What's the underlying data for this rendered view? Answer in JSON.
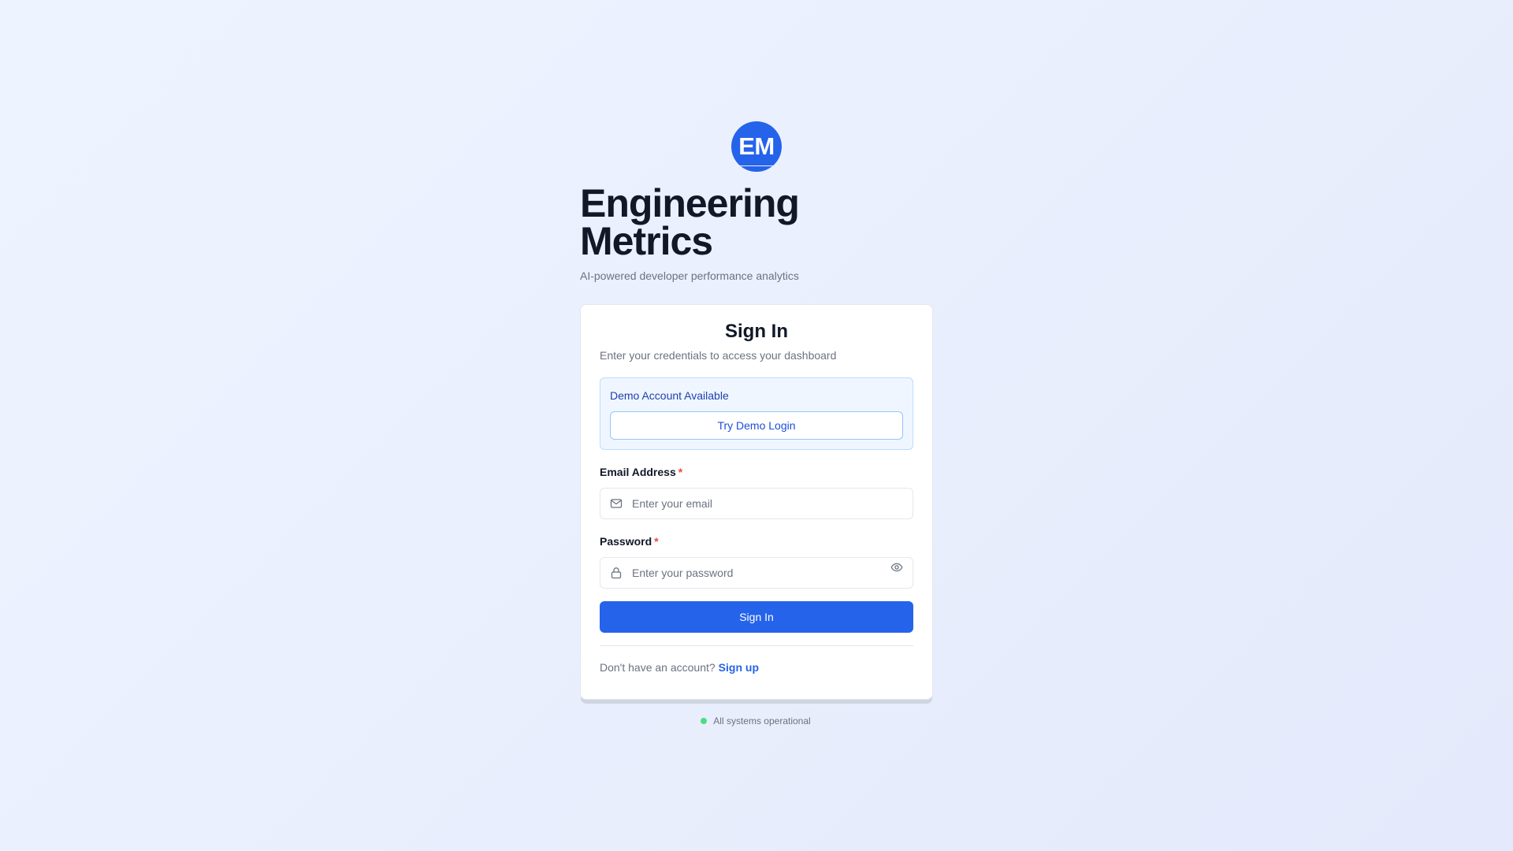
{
  "brand": {
    "logo_text": "EM",
    "title": "Engineering Metrics",
    "subtitle": "AI-powered developer performance analytics",
    "accent_color": "#2563eb"
  },
  "card": {
    "title": "Sign In",
    "description": "Enter your credentials to access your dashboard"
  },
  "demo": {
    "label": "Demo Account Available",
    "button_label": "Try Demo Login"
  },
  "email": {
    "label": "Email Address",
    "required_mark": "*",
    "placeholder": "Enter your email",
    "icon": "mail-icon"
  },
  "password": {
    "label": "Password",
    "required_mark": "*",
    "placeholder": "Enter your password",
    "icon": "lock-icon",
    "toggle_icon": "eye-icon"
  },
  "submit": {
    "label": "Sign In"
  },
  "signup": {
    "prompt": "Don't have an account?",
    "link_label": "Sign up"
  },
  "status": {
    "text": "All systems operational",
    "color": "#4ade80"
  }
}
